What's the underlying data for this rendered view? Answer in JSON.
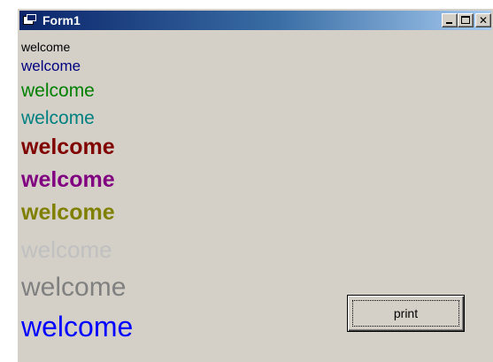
{
  "window": {
    "title": "Form1",
    "app_icon": "form-window-icon",
    "minimize_icon": "minimize-icon",
    "maximize_icon": "maximize-icon",
    "close_icon": "close-icon",
    "close_glyph": "✕"
  },
  "lines": [
    {
      "text": "welcome",
      "color": "#000000"
    },
    {
      "text": "welcome",
      "color": "#000080"
    },
    {
      "text": "welcome",
      "color": "#008000"
    },
    {
      "text": "welcome",
      "color": "#008080"
    },
    {
      "text": "welcome",
      "color": "#800000"
    },
    {
      "text": "welcome",
      "color": "#800080"
    },
    {
      "text": "welcome",
      "color": "#808000"
    },
    {
      "text": "welcome",
      "color": "#c0c0c0"
    },
    {
      "text": "welcome",
      "color": "#808080"
    },
    {
      "text": "welcome",
      "color": "#0000ff"
    }
  ],
  "print_button": {
    "label": "print"
  }
}
